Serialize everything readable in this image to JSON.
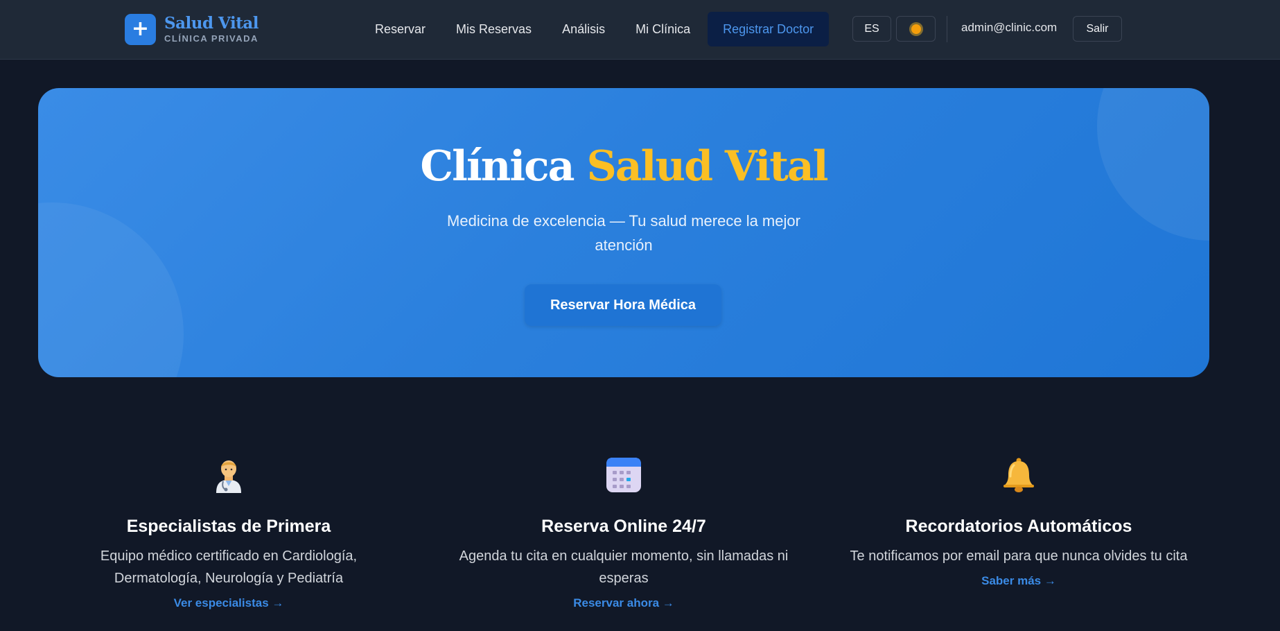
{
  "brand": {
    "logo_symbol": "+",
    "name": "Salud Vital",
    "subtitle": "CLÍNICA PRIVADA"
  },
  "nav": {
    "links": [
      "Reservar",
      "Mis Reservas",
      "Análisis",
      "Mi Clínica",
      "Registrar Doctor"
    ],
    "active": "Registrar Doctor",
    "language": "ES",
    "theme_icon": "sun-icon",
    "user_email": "admin@clinic.com",
    "logout": "Salir"
  },
  "hero": {
    "title_main": "Clínica",
    "title_accent": "Salud Vital",
    "subtitle": "Medicina de excelencia — Tu salud merece la mejor atención",
    "cta": "Reservar Hora Médica"
  },
  "features": [
    {
      "icon": "doctor-icon",
      "title": "Especialistas de Primera",
      "description": "Equipo médico certificado en Cardiología, Dermatología, Neurología y Pediatría",
      "link": "Ver especialistas →"
    },
    {
      "icon": "calendar-icon",
      "title": "Reserva Online 24/7",
      "description": "Agenda tu cita en cualquier momento, sin llamadas ni esperas",
      "link": "Reservar ahora →"
    },
    {
      "icon": "bell-icon",
      "title": "Recordatorios Automáticos",
      "description": "Te notificamos por email para que nunca olvides tu cita",
      "link": "Saber más →"
    }
  ],
  "colors": {
    "background": "#111827",
    "navbar": "#1f2937",
    "primary": "#2a7de1",
    "accent": "#fbbf24",
    "link": "#3b8be6"
  }
}
